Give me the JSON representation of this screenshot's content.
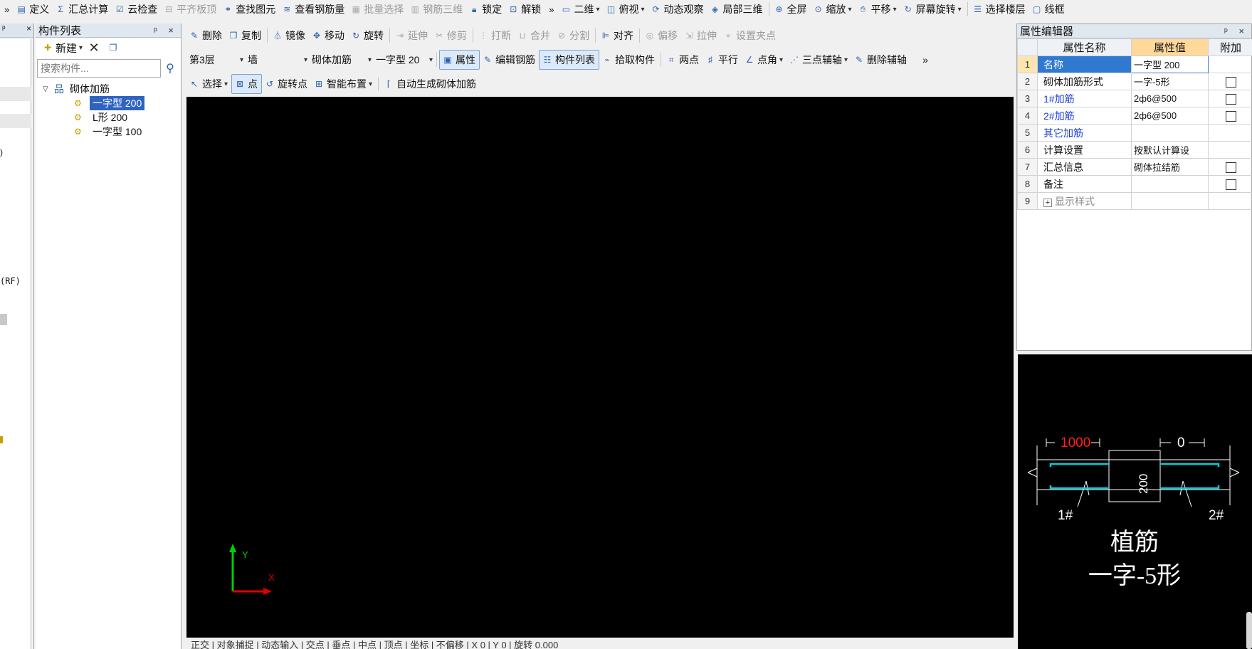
{
  "main_toolbar": {
    "overflow_left": "»",
    "items": [
      {
        "label": "定义",
        "icon": "define-icon",
        "enabled": true
      },
      {
        "label": "汇总计算",
        "icon": "sigma-icon",
        "enabled": true
      },
      {
        "label": "云检查",
        "icon": "cloud-check-icon",
        "enabled": true
      },
      {
        "label": "平齐板顶",
        "icon": "align-slab-icon",
        "enabled": false
      },
      {
        "label": "查找图元",
        "icon": "binoculars-icon",
        "enabled": true
      },
      {
        "label": "查看钢筋量",
        "icon": "view-rebar-icon",
        "enabled": true
      },
      {
        "label": "批量选择",
        "icon": "batch-select-icon",
        "enabled": false
      },
      {
        "label": "钢筋三维",
        "icon": "rebar-3d-icon",
        "enabled": false
      },
      {
        "label": "锁定",
        "icon": "lock-icon",
        "enabled": true
      },
      {
        "label": "解锁",
        "icon": "unlock-icon",
        "enabled": true
      }
    ],
    "overflow_mid": "»",
    "view_items": [
      {
        "label": "二维",
        "icon": "2d-icon",
        "dropdown": true
      },
      {
        "label": "俯视",
        "icon": "top-view-icon",
        "dropdown": true
      },
      {
        "label": "动态观察",
        "icon": "orbit-icon",
        "dropdown": false
      },
      {
        "label": "局部三维",
        "icon": "local-3d-icon",
        "dropdown": false
      },
      {
        "label": "全屏",
        "icon": "fullscreen-icon",
        "dropdown": false
      },
      {
        "label": "缩放",
        "icon": "zoom-icon",
        "dropdown": true
      },
      {
        "label": "平移",
        "icon": "pan-icon",
        "dropdown": true
      },
      {
        "label": "屏幕旋转",
        "icon": "screen-rotate-icon",
        "dropdown": true
      },
      {
        "label": "选择楼层",
        "icon": "floor-select-icon",
        "dropdown": false
      },
      {
        "label": "线框",
        "icon": "wireframe-icon",
        "dropdown": false
      }
    ]
  },
  "left_strip": {
    "title_pin": "ᵖ",
    "title_close": "×",
    "frag1": ")",
    "frag2": "(RF)"
  },
  "component_panel": {
    "title": "构件列表",
    "pin": "ᵖ",
    "close": "×",
    "new_label": "新建",
    "search_placeholder": "搜索构件...",
    "tree_root": "砌体加筋",
    "tree_items": [
      {
        "label": "一字型 200",
        "selected": true
      },
      {
        "label": "L形 200",
        "selected": false
      },
      {
        "label": "一字型 100",
        "selected": false
      }
    ]
  },
  "edit_toolbar": [
    {
      "label": "删除",
      "icon": "delete-icon",
      "enabled": true
    },
    {
      "label": "复制",
      "icon": "copy-icon",
      "enabled": true
    },
    {
      "label": "镜像",
      "icon": "mirror-icon",
      "enabled": true
    },
    {
      "label": "移动",
      "icon": "move-icon",
      "enabled": true
    },
    {
      "label": "旋转",
      "icon": "rotate-icon",
      "enabled": true
    },
    {
      "label": "延伸",
      "icon": "extend-icon",
      "enabled": false
    },
    {
      "label": "修剪",
      "icon": "trim-icon",
      "enabled": false
    },
    {
      "label": "打断",
      "icon": "break-icon",
      "enabled": false
    },
    {
      "label": "合并",
      "icon": "merge-icon",
      "enabled": false
    },
    {
      "label": "分割",
      "icon": "split-icon",
      "enabled": false
    },
    {
      "label": "对齐",
      "icon": "align-icon",
      "enabled": true
    },
    {
      "label": "偏移",
      "icon": "offset-icon",
      "enabled": false
    },
    {
      "label": "拉伸",
      "icon": "stretch-icon",
      "enabled": false
    },
    {
      "label": "设置夹点",
      "icon": "grip-icon",
      "enabled": false
    }
  ],
  "selectors": {
    "floor": "第3层",
    "category": "墙",
    "type": "砌体加筋",
    "component": "一字型 20"
  },
  "row2_buttons": [
    {
      "label": "属性",
      "icon": "property-icon",
      "active": true
    },
    {
      "label": "编辑钢筋",
      "icon": "edit-rebar-icon",
      "active": false
    },
    {
      "label": "构件列表",
      "icon": "component-list-icon",
      "active": true
    },
    {
      "label": "拾取构件",
      "icon": "pick-icon",
      "active": false
    }
  ],
  "axis_tools": [
    {
      "label": "两点",
      "icon": "two-point-icon",
      "dropdown": false
    },
    {
      "label": "平行",
      "icon": "parallel-icon",
      "dropdown": false
    },
    {
      "label": "点角",
      "icon": "point-angle-icon",
      "dropdown": true
    },
    {
      "label": "三点辅轴",
      "icon": "three-point-icon",
      "dropdown": true
    },
    {
      "label": "删除辅轴",
      "icon": "delete-aux-icon",
      "dropdown": false
    }
  ],
  "row2_overflow": "»",
  "draw_toolbar": [
    {
      "label": "选择",
      "icon": "select-arrow-icon",
      "dropdown": true,
      "active": false
    },
    {
      "label": "点",
      "icon": "point-icon",
      "dropdown": false,
      "active": true
    },
    {
      "label": "旋转点",
      "icon": "rotate-point-icon",
      "dropdown": false,
      "active": false
    },
    {
      "label": "智能布置",
      "icon": "smart-layout-icon",
      "dropdown": true,
      "active": false
    },
    {
      "label": "自动生成砌体加筋",
      "icon": "auto-generate-icon",
      "dropdown": false,
      "active": false
    }
  ],
  "canvas": {
    "axis_y": "Y",
    "axis_x": "X"
  },
  "bottom_bar": {
    "text": "正交 | 对象捕捉 | 动态输入 | 交点 | 垂点 | 中点 | 顶点 | 坐标 | 不偏移 | X 0 | Y 0 | 旋转 0.000"
  },
  "property_editor": {
    "title": "属性编辑器",
    "pin": "ᵖ",
    "close": "×",
    "headers": {
      "name": "属性名称",
      "value": "属性值",
      "extra": "附加"
    },
    "rows": [
      {
        "num": "1",
        "name": "名称",
        "value": "一字型 200",
        "blue": false,
        "selected": true,
        "checkbox": false
      },
      {
        "num": "2",
        "name": "砌体加筋形式",
        "value": "一字-5形",
        "blue": false,
        "selected": false,
        "checkbox": true
      },
      {
        "num": "3",
        "name": "1#加筋",
        "value": "2ф6@500",
        "blue": true,
        "selected": false,
        "checkbox": true
      },
      {
        "num": "4",
        "name": "2#加筋",
        "value": "2ф6@500",
        "blue": true,
        "selected": false,
        "checkbox": true
      },
      {
        "num": "5",
        "name": "其它加筋",
        "value": "",
        "blue": true,
        "selected": false,
        "checkbox": false
      },
      {
        "num": "6",
        "name": "计算设置",
        "value": "按默认计算设",
        "blue": false,
        "selected": false,
        "checkbox": false
      },
      {
        "num": "7",
        "name": "汇总信息",
        "value": "砌体拉结筋",
        "blue": false,
        "selected": false,
        "checkbox": true
      },
      {
        "num": "8",
        "name": "备注",
        "value": "",
        "blue": false,
        "selected": false,
        "checkbox": true
      },
      {
        "num": "9",
        "name": "显示样式",
        "value": "",
        "blue": false,
        "gray": true,
        "expandable": true,
        "selected": false,
        "checkbox": false
      }
    ]
  },
  "preview": {
    "dim_left": "1000",
    "dim_right": "0",
    "dim_vertical": "200",
    "label_1": "1#",
    "label_2": "2#",
    "caption_1": "植筋",
    "caption_2": "一字-5形"
  }
}
